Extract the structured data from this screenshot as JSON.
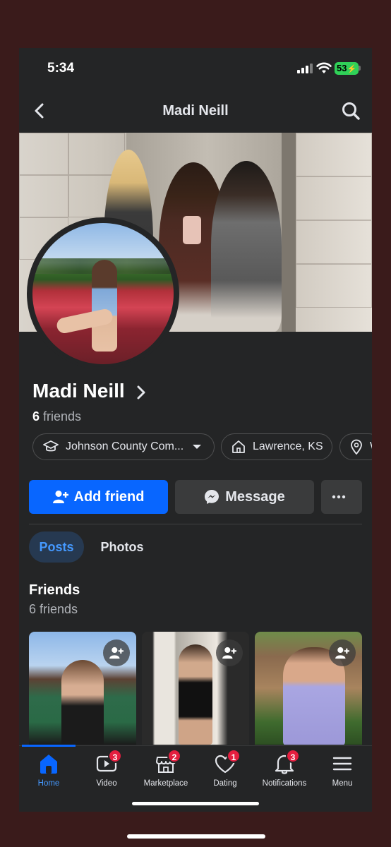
{
  "status_bar": {
    "time": "5:34",
    "battery": "53"
  },
  "header": {
    "title": "Madi Neill",
    "back_icon": "chevron-left-icon",
    "search_icon": "search-icon"
  },
  "profile": {
    "name": "Madi Neill",
    "friends_count": "6",
    "friends_word": "friends"
  },
  "chips": [
    {
      "icon": "graduation-cap-icon",
      "label": "Johnson County Com..."
    },
    {
      "icon": "home-icon",
      "label": "Lawrence, KS"
    },
    {
      "icon": "location-pin-icon",
      "label": "W"
    }
  ],
  "actions": {
    "add_friend": "Add friend",
    "message": "Message"
  },
  "tabs": [
    {
      "label": "Posts",
      "active": true
    },
    {
      "label": "Photos",
      "active": false
    }
  ],
  "friends_section": {
    "title": "Friends",
    "subtitle": "6 friends"
  },
  "bottom_nav": [
    {
      "label": "Home",
      "icon": "home-icon",
      "badge": "",
      "active": true
    },
    {
      "label": "Video",
      "icon": "video-icon",
      "badge": "3",
      "active": false
    },
    {
      "label": "Marketplace",
      "icon": "marketplace-icon",
      "badge": "2",
      "active": false
    },
    {
      "label": "Dating",
      "icon": "heart-icon",
      "badge": "1",
      "active": false
    },
    {
      "label": "Notifications",
      "icon": "bell-icon",
      "badge": "3",
      "active": false
    },
    {
      "label": "Menu",
      "icon": "menu-icon",
      "badge": "",
      "active": false
    }
  ],
  "colors": {
    "accent": "#0866ff",
    "background": "#242526",
    "badge": "#e41e3f",
    "outer": "#3a1b1b"
  }
}
